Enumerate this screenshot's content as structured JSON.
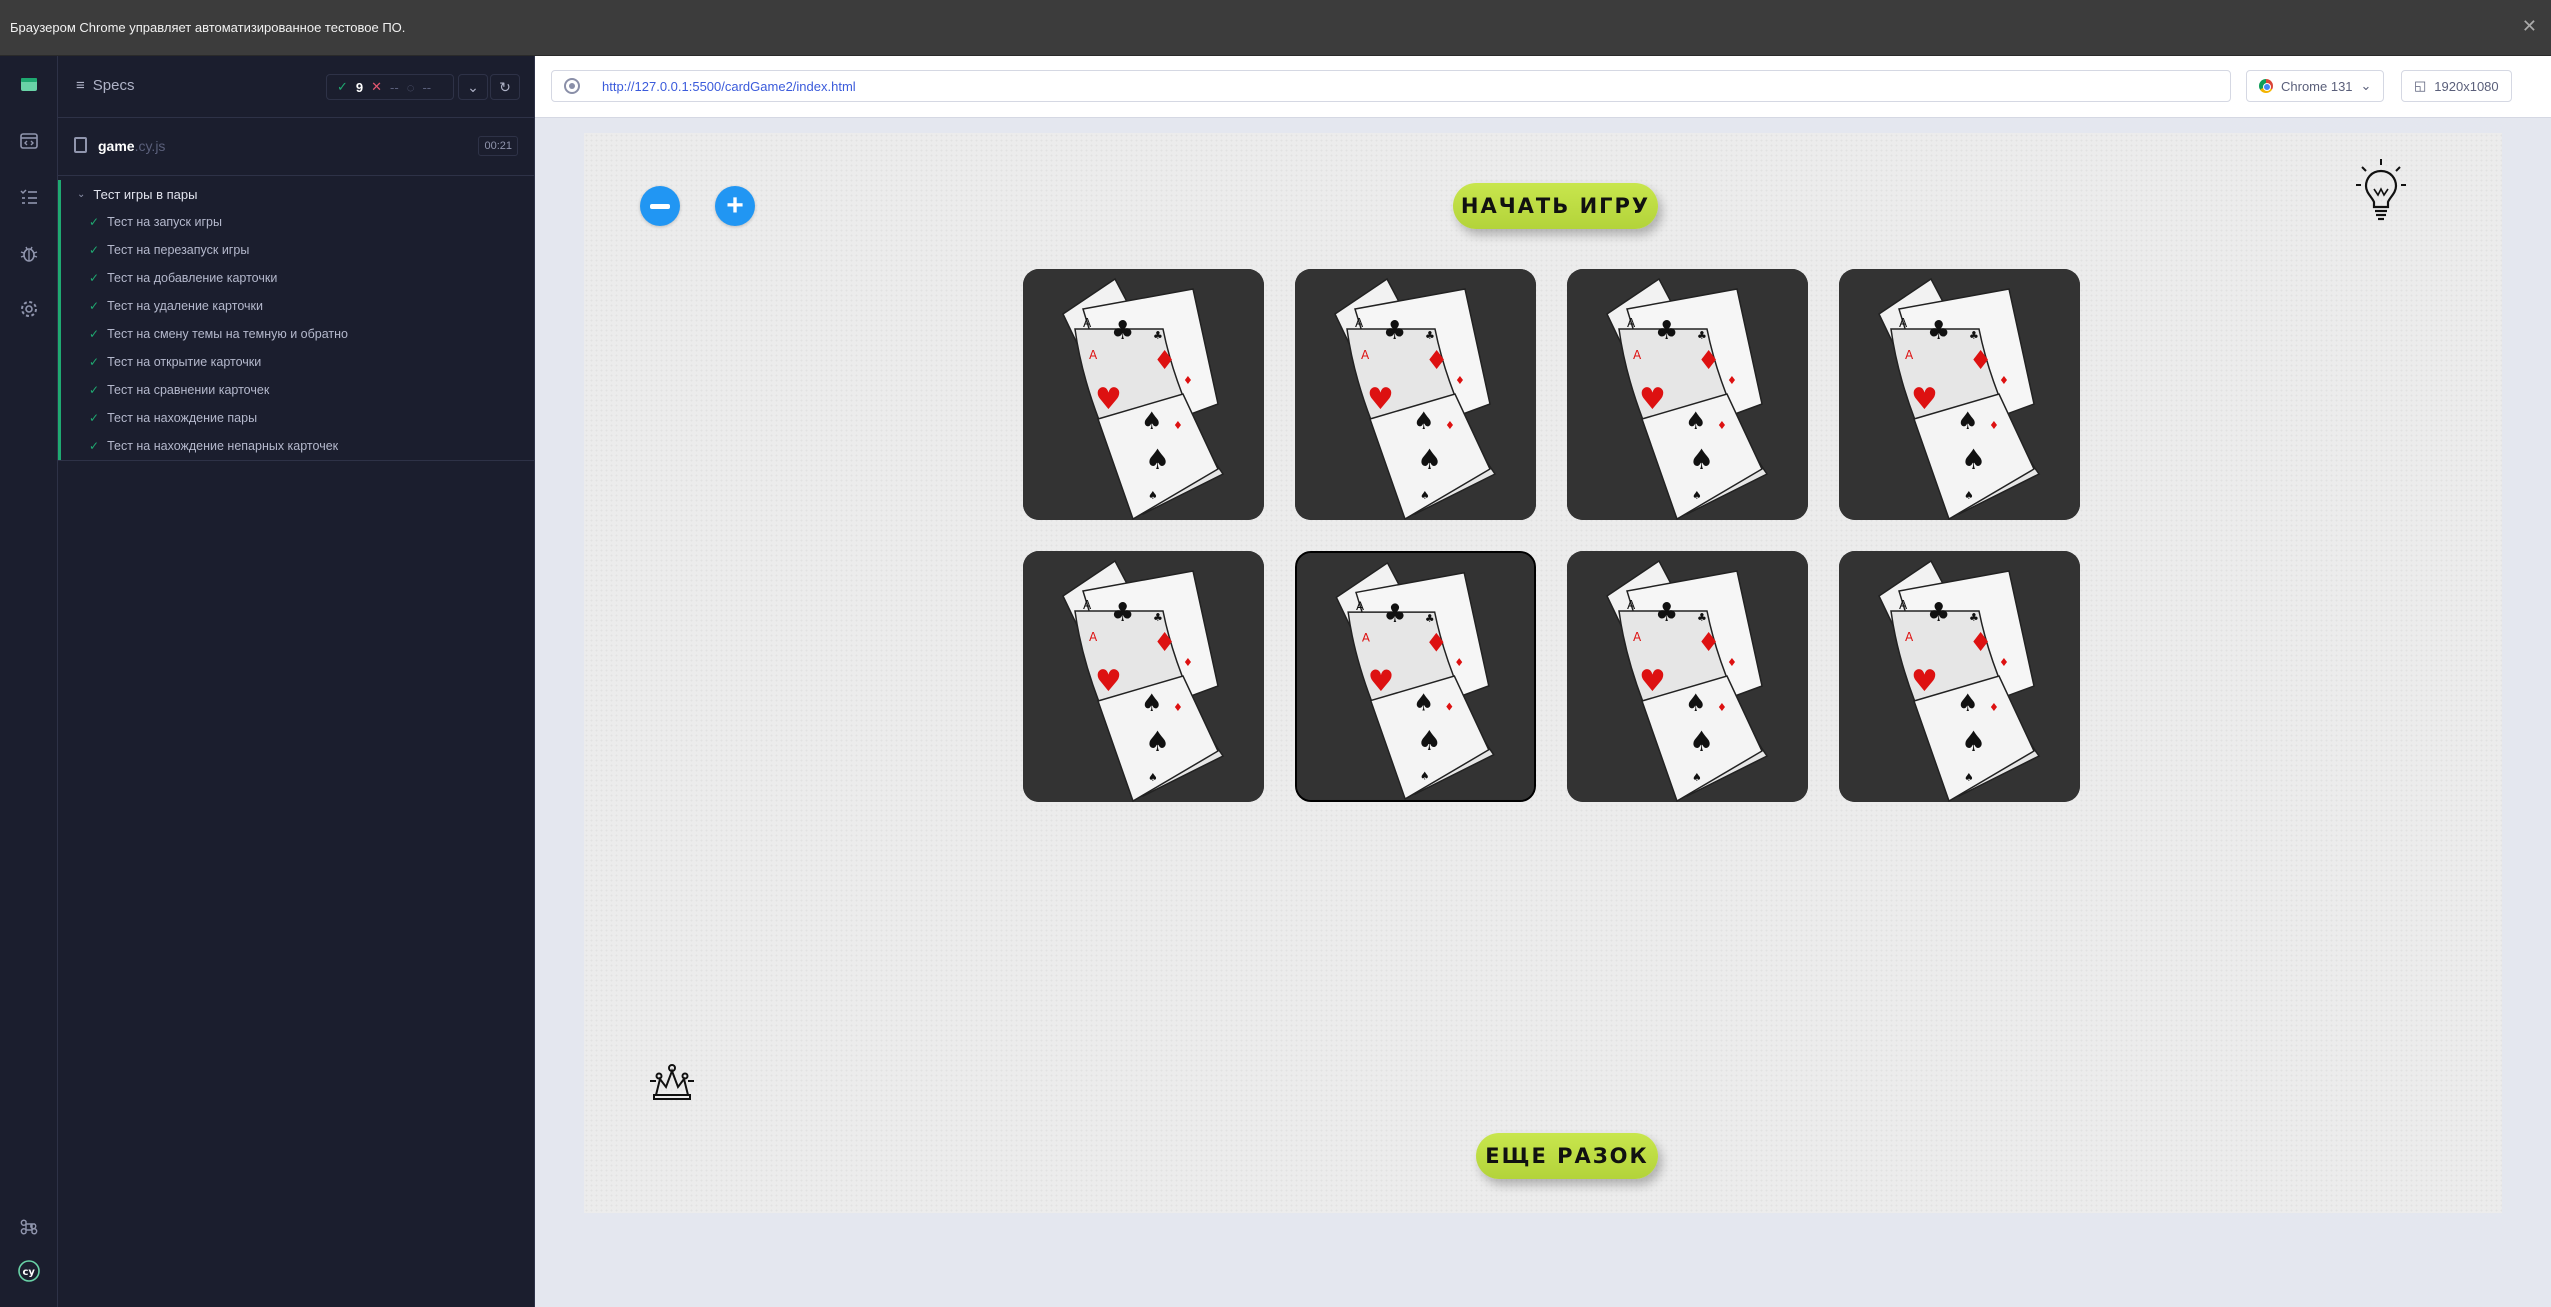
{
  "infobar": {
    "text": "Браузером Chrome управляет автоматизированное тестовое ПО.",
    "close_glyph": "✕"
  },
  "rail": {
    "items": [
      "cypress-logo-icon",
      "runs-icon",
      "specs-list-icon",
      "debug-icon",
      "settings-icon",
      "keyboard-shortcuts-icon",
      "cypress-cy-icon"
    ]
  },
  "specs": {
    "title": "Specs",
    "stats": {
      "passed": "9",
      "failed": "--",
      "pending": "--"
    },
    "file": {
      "name": "game",
      "ext": ".cy.js",
      "duration": "00:21"
    },
    "suite": {
      "title": "Тест игры в пары",
      "tests": [
        "Тест на запуск игры",
        "Тест на перезапуск игры",
        "Тест на добавление карточки",
        "Тест на удаление карточки",
        "Тест на смену темы на темную и обратно",
        "Тест на открытие карточки",
        "Тест на сравнении карточек",
        "Тест на нахождение пары",
        "Тест на нахождение непарных карточек"
      ]
    }
  },
  "browser": {
    "url": "http://127.0.0.1:5500/cardGame2/index.html",
    "browser_name": "Chrome 131",
    "viewport_size": "1920x1080"
  },
  "game": {
    "start_button": "НАЧАТЬ ИГРУ",
    "restart_button": "ЕЩЕ РАЗОК",
    "card_count": 8,
    "colors": {
      "button": "#c2df47",
      "card_back": "#333333",
      "round_button": "#2196f3"
    }
  }
}
